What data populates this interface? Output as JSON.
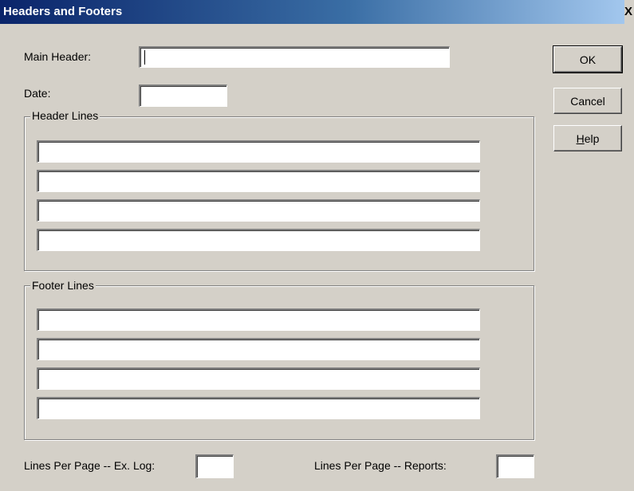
{
  "window": {
    "title": "Headers and Footers",
    "close_glyph": "X"
  },
  "main_header": {
    "label": "Main Header:",
    "value": ""
  },
  "date": {
    "label": "Date:",
    "value": ""
  },
  "header_lines": {
    "legend": "Header Lines",
    "values": [
      "",
      "",
      "",
      ""
    ]
  },
  "footer_lines": {
    "legend": "Footer Lines",
    "values": [
      "",
      "",
      "",
      ""
    ]
  },
  "lines_per_page_exlog": {
    "label": "Lines Per Page -- Ex. Log:",
    "value": ""
  },
  "lines_per_page_reports": {
    "label": "Lines Per Page -- Reports:",
    "value": ""
  },
  "buttons": {
    "ok": "OK",
    "cancel": "Cancel",
    "help_mnemonic": "H",
    "help_rest": "elp"
  }
}
